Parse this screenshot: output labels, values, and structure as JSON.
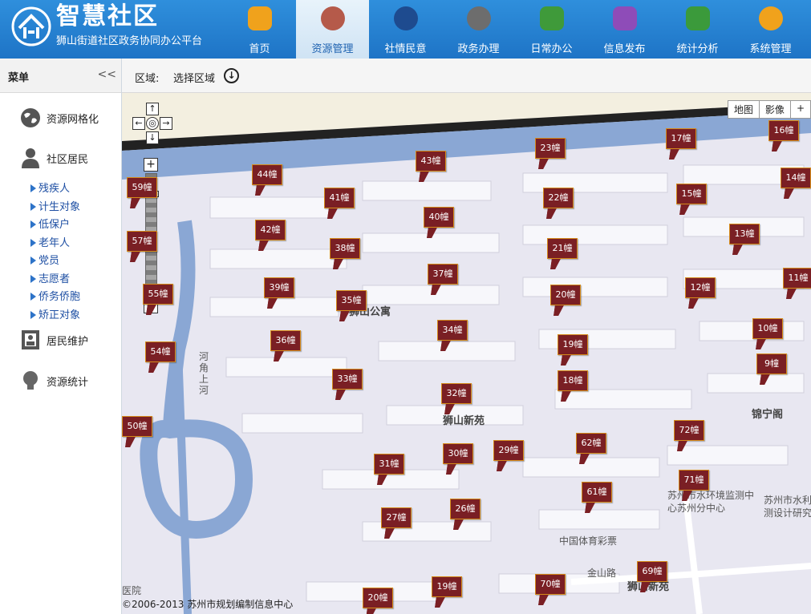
{
  "brand": {
    "title": "智慧社区",
    "subtitle": "狮山街道社区政务协同办公平台"
  },
  "nav": [
    {
      "label": "首页",
      "icon": "home-icon",
      "color": "#f0a21c"
    },
    {
      "label": "资源管理",
      "icon": "people-icon",
      "color": "#b55a4a",
      "active": true
    },
    {
      "label": "社情民意",
      "icon": "police-icon",
      "color": "#1e4b8f"
    },
    {
      "label": "政务办理",
      "icon": "stamp-icon",
      "color": "#6d6d6d"
    },
    {
      "label": "日常办公",
      "icon": "meeting-icon",
      "color": "#3f9a3a"
    },
    {
      "label": "信息发布",
      "icon": "edit-icon",
      "color": "#8e4cb8"
    },
    {
      "label": "统计分析",
      "icon": "chart-icon",
      "color": "#3b9a3b"
    },
    {
      "label": "系统管理",
      "icon": "gear-icon",
      "color": "#f0a21c"
    }
  ],
  "sidebar": {
    "title": "菜单",
    "collapse": "<<",
    "groups": [
      {
        "label": "资源网格化",
        "icon": "globe-icon"
      },
      {
        "label": "社区居民",
        "icon": "person-icon"
      },
      {
        "label": "居民维护",
        "icon": "id-card-icon"
      },
      {
        "label": "资源统计",
        "icon": "bulb-icon"
      }
    ],
    "items": [
      "残疾人",
      "计生对象",
      "低保户",
      "老年人",
      "党员",
      "志愿者",
      "侨务侨胞",
      "矫正对象"
    ]
  },
  "region": {
    "label": "区域:",
    "select": "选择区域"
  },
  "map": {
    "switch": [
      "地图",
      "影像",
      "+"
    ],
    "copyright": "©2006-2013 苏州市规划编制信息中心",
    "places": [
      {
        "text": "狮山公寓",
        "cls": "bold"
      },
      {
        "text": "狮山新苑",
        "cls": "bold"
      },
      {
        "text": "锦宁阁",
        "cls": "bold"
      },
      {
        "text": "苏州市水环境监测中心苏州分中心",
        "cls": ""
      },
      {
        "text": "苏州市水利测设计研究",
        "cls": ""
      },
      {
        "text": "中国体育彩票",
        "cls": ""
      },
      {
        "text": "金山路",
        "cls": ""
      },
      {
        "text": "狮山新苑",
        "cls": "bold"
      },
      {
        "text": "河角上河",
        "cls": ""
      },
      {
        "text": "医院",
        "cls": ""
      }
    ],
    "pins": [
      "16幢",
      "17幢",
      "23幢",
      "43幢",
      "44幢",
      "59幢",
      "14幢",
      "15幢",
      "22幢",
      "41幢",
      "40幢",
      "42幢",
      "13幢",
      "21幢",
      "38幢",
      "57幢",
      "11幢",
      "37幢",
      "12幢",
      "39幢",
      "20幢",
      "35幢",
      "55幢",
      "10幢",
      "34幢",
      "36幢",
      "19幢",
      "54幢",
      "9幢",
      "18幢",
      "33幢",
      "32幢",
      "50幢",
      "72幢",
      "62幢",
      "29幢",
      "30幢",
      "31幢",
      "71幢",
      "61幢",
      "26幢",
      "27幢",
      "69幢",
      "70幢",
      "19幢",
      "20幢"
    ]
  }
}
